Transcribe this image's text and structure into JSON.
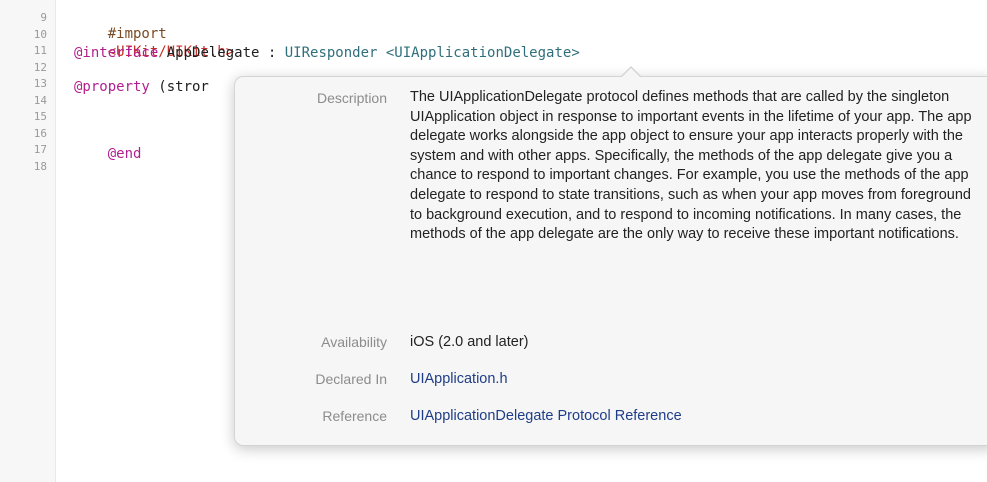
{
  "editor": {
    "line_numbers": [
      "9",
      "10",
      "11",
      "12",
      "13",
      "14",
      "15",
      "16",
      "17",
      "18"
    ],
    "lines": {
      "import_directive": "#import",
      "import_path": "<UIKit/UIKit.h>",
      "interface_kw": "@interface",
      "interface_name": " AppDelegate : ",
      "interface_super": "UIResponder",
      "interface_protocol": " <UIApplicationDelegate>",
      "property_kw": "@property",
      "property_rest": " (stror",
      "end_kw": "@end"
    }
  },
  "quick_help": {
    "description_label": "Description",
    "description_text": "The UIApplicationDelegate protocol defines methods that are called by the singleton UIApplication object in response to important events in the lifetime of your app. The app delegate works alongside the app object to ensure your app interacts properly with the system and with other apps. Specifically, the methods of the app delegate give you a chance to respond to important changes. For example, you use the methods of the app delegate to respond to state transitions, such as when your app moves from foreground to background execution, and to respond to incoming notifications. In many cases, the methods of the app delegate are the only way to receive these important notifications.",
    "availability_label": "Availability",
    "availability_value": "iOS (2.0 and later)",
    "declared_label": "Declared In",
    "declared_value": "UIApplication.h",
    "reference_label": "Reference",
    "reference_value": "UIApplicationDelegate Protocol Reference"
  }
}
